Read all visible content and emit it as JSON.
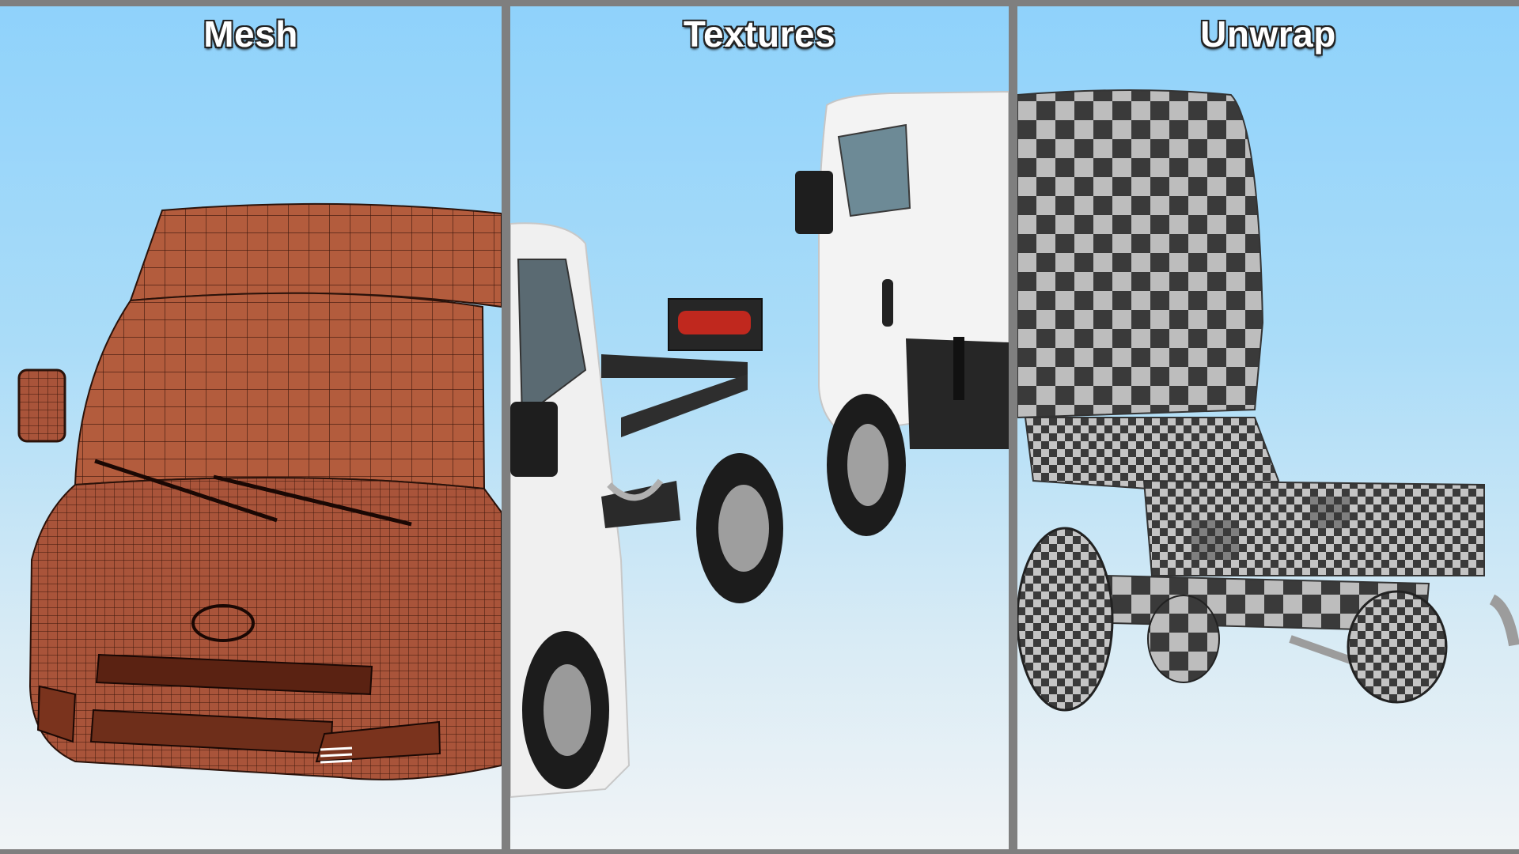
{
  "panels": [
    {
      "title": "Mesh"
    },
    {
      "title": "Textures"
    },
    {
      "title": "Unwrap"
    }
  ],
  "colors": {
    "mesh_body": "#b05a3c",
    "wireframe": "#2a120a",
    "truck_white": "#f2f2f2",
    "chassis": "#2a2a2a",
    "tail_light": "#c0281e",
    "checker_dark": "#3c3c3c",
    "checker_light": "#b8b8b8",
    "divider": "#808080"
  }
}
